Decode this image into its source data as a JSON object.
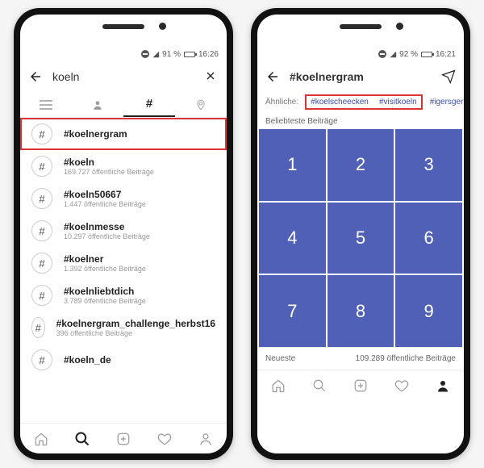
{
  "left": {
    "status": {
      "battery": "91 %",
      "time": "16:26"
    },
    "search_query": "koeln",
    "tabs": {
      "top": "≡",
      "people": "👤",
      "hash": "#",
      "places": "⌖"
    },
    "results": [
      {
        "tag": "#koelnergram",
        "sub": "",
        "highlight": true
      },
      {
        "tag": "#koeln",
        "sub": "169.727 öffentliche Beiträge"
      },
      {
        "tag": "#koeln50667",
        "sub": "1.447 öffentliche Beiträge"
      },
      {
        "tag": "#koelnmesse",
        "sub": "10.297 öffentliche Beiträge"
      },
      {
        "tag": "#koelner",
        "sub": "1.392 öffentliche Beiträge"
      },
      {
        "tag": "#koelnliebtdich",
        "sub": "3.789 öffentliche Beiträge"
      },
      {
        "tag": "#koelnergram_challenge_herbst16",
        "sub": "396 öffentliche Beiträge"
      },
      {
        "tag": "#koeln_de",
        "sub": ""
      }
    ],
    "nav_active": "search"
  },
  "right": {
    "status": {
      "battery": "92 %",
      "time": "16:21"
    },
    "header_title": "#koelnergram",
    "similar_label": "Ähnliche:",
    "similar_tags": [
      "#koelscheecken",
      "#visitkoeln",
      "#igersgerma"
    ],
    "section_top": "Beliebteste Beiträge",
    "grid": [
      "1",
      "2",
      "3",
      "4",
      "5",
      "6",
      "7",
      "8",
      "9"
    ],
    "newest_label": "Neueste",
    "newest_count": "109.289 öffentliche Beiträge",
    "nav_active": "profile"
  }
}
